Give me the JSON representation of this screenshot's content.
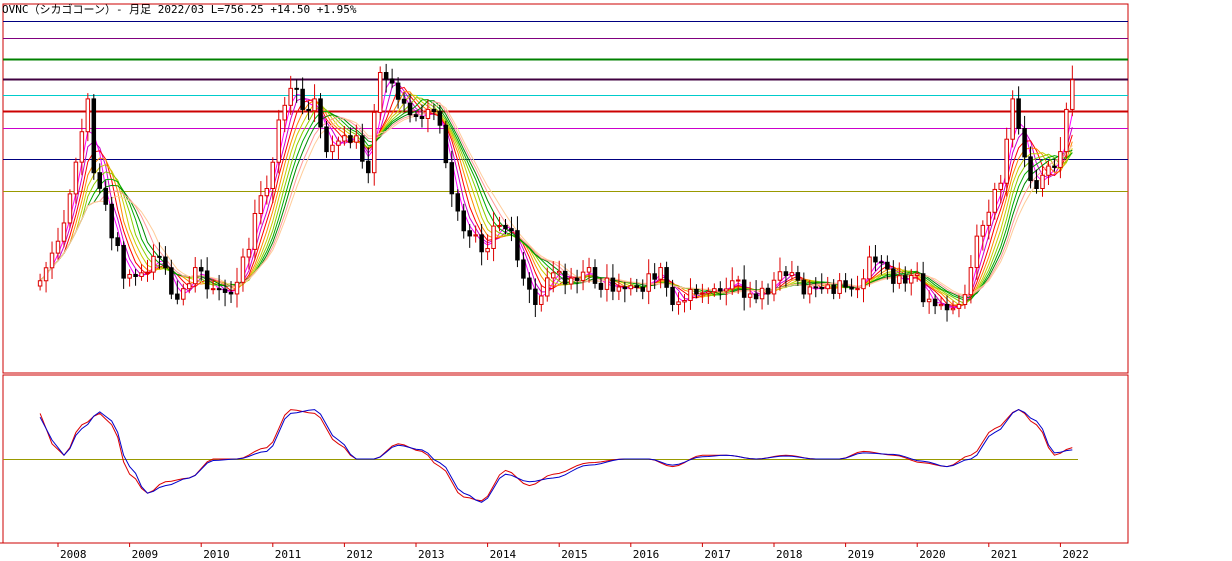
{
  "header": {
    "title": "OVNC（シカゴコーン）- 月足 2022/03 L=756.25 +14.50 +1.95%"
  },
  "colors": {
    "frame": "#cc0000",
    "up_candle": "#dd0000",
    "down_candle": "#000000",
    "oscillator_red": "#dd0000",
    "oscillator_blue": "#0000cc",
    "zero_line": "#999900",
    "ribbon": [
      "#ff00ff",
      "#cc00cc",
      "#ff0000",
      "#ff8800",
      "#cccc00",
      "#88cc00",
      "#00aa00",
      "#008800",
      "#ff9999",
      "#ffcc99"
    ]
  },
  "chart_data": [
    {
      "type": "candlestick",
      "title": "OVNC（シカゴコーン）- 月足 2022/03 L=756.25 +14.50 +1.95%",
      "xlabel": "",
      "ylabel": "",
      "x_tick_labels": [
        "2008",
        "2009",
        "2010",
        "2011",
        "2012",
        "2013",
        "2014",
        "2015",
        "2016",
        "2017",
        "2018",
        "2019",
        "2020",
        "2021",
        "2022"
      ],
      "ylim": [
        200,
        900
      ],
      "horizontal_lines": [
        {
          "value": 868,
          "color": "#000080"
        },
        {
          "value": 836,
          "color": "#800080"
        },
        {
          "value": 795,
          "color": "#008000"
        },
        {
          "value": 758,
          "color": "#400040"
        },
        {
          "value": 727,
          "color": "#00cccc"
        },
        {
          "value": 697,
          "color": "#cc0000"
        },
        {
          "value": 664,
          "color": "#cc00cc"
        },
        {
          "value": 606,
          "color": "#000080"
        },
        {
          "value": 546,
          "color": "#999900"
        }
      ],
      "series": [
        {
          "name": "",
          "period_start": "2007-10",
          "period_end": "2022-03",
          "close_anchors": [
            [
              "2007-10",
              375
            ],
            [
              "2008-01",
              450
            ],
            [
              "2008-04",
              600
            ],
            [
              "2008-06",
              720
            ],
            [
              "2008-07",
              580
            ],
            [
              "2008-09",
              520
            ],
            [
              "2008-12",
              380
            ],
            [
              "2009-03",
              390
            ],
            [
              "2009-06",
              420
            ],
            [
              "2009-09",
              340
            ],
            [
              "2009-12",
              400
            ],
            [
              "2010-03",
              360
            ],
            [
              "2010-06",
              350
            ],
            [
              "2010-08",
              420
            ],
            [
              "2010-12",
              550
            ],
            [
              "2011-02",
              680
            ],
            [
              "2011-04",
              740
            ],
            [
              "2011-06",
              700
            ],
            [
              "2011-08",
              720
            ],
            [
              "2011-10",
              620
            ],
            [
              "2011-12",
              640
            ],
            [
              "2012-03",
              650
            ],
            [
              "2012-05",
              580
            ],
            [
              "2012-07",
              770
            ],
            [
              "2012-09",
              750
            ],
            [
              "2012-12",
              690
            ],
            [
              "2013-03",
              700
            ],
            [
              "2013-05",
              670
            ],
            [
              "2013-07",
              540
            ],
            [
              "2013-10",
              460
            ],
            [
              "2013-12",
              430
            ],
            [
              "2014-03",
              480
            ],
            [
              "2014-05",
              470
            ],
            [
              "2014-07",
              380
            ],
            [
              "2014-09",
              330
            ],
            [
              "2014-12",
              390
            ],
            [
              "2015-03",
              380
            ],
            [
              "2015-06",
              400
            ],
            [
              "2015-07",
              370
            ],
            [
              "2015-09",
              380
            ],
            [
              "2015-12",
              360
            ],
            [
              "2016-03",
              355
            ],
            [
              "2016-06",
              400
            ],
            [
              "2016-08",
              330
            ],
            [
              "2016-12",
              350
            ],
            [
              "2017-03",
              360
            ],
            [
              "2017-06",
              375
            ],
            [
              "2017-09",
              350
            ],
            [
              "2017-12",
              350
            ],
            [
              "2018-03",
              385
            ],
            [
              "2018-06",
              350
            ],
            [
              "2018-09",
              360
            ],
            [
              "2018-12",
              375
            ],
            [
              "2019-03",
              360
            ],
            [
              "2019-05",
              420
            ],
            [
              "2019-07",
              410
            ],
            [
              "2019-09",
              370
            ],
            [
              "2019-12",
              385
            ],
            [
              "2020-03",
              340
            ],
            [
              "2020-06",
              320
            ],
            [
              "2020-08",
              330
            ],
            [
              "2020-10",
              400
            ],
            [
              "2020-12",
              480
            ],
            [
              "2021-03",
              560
            ],
            [
              "2021-05",
              720
            ],
            [
              "2021-07",
              610
            ],
            [
              "2021-09",
              550
            ],
            [
              "2021-12",
              590
            ],
            [
              "2022-01",
              620
            ],
            [
              "2022-02",
              700
            ],
            [
              "2022-03",
              756.25
            ]
          ]
        }
      ]
    },
    {
      "type": "line",
      "title": "",
      "xlabel": "",
      "ylabel": "",
      "ylim": [
        -1,
        1
      ],
      "series": [
        {
          "name": "",
          "color_key": "oscillator_red",
          "anchors": [
            [
              "2007-10",
              0.6
            ],
            [
              "2007-12",
              0.2
            ],
            [
              "2008-02",
              0.05
            ],
            [
              "2008-05",
              0.45
            ],
            [
              "2008-08",
              0.6
            ],
            [
              "2008-10",
              0.45
            ],
            [
              "2009-01",
              -0.2
            ],
            [
              "2009-04",
              -0.45
            ],
            [
              "2009-07",
              -0.3
            ],
            [
              "2009-11",
              -0.25
            ],
            [
              "2010-03",
              0.0
            ],
            [
              "2010-07",
              0.0
            ],
            [
              "2010-12",
              0.15
            ],
            [
              "2011-04",
              0.65
            ],
            [
              "2011-08",
              0.6
            ],
            [
              "2011-12",
              0.2
            ],
            [
              "2012-03",
              0.0
            ],
            [
              "2012-06",
              0.0
            ],
            [
              "2012-10",
              0.2
            ],
            [
              "2013-02",
              0.1
            ],
            [
              "2013-05",
              -0.1
            ],
            [
              "2013-09",
              -0.5
            ],
            [
              "2013-12",
              -0.55
            ],
            [
              "2014-04",
              -0.15
            ],
            [
              "2014-08",
              -0.35
            ],
            [
              "2014-12",
              -0.2
            ],
            [
              "2015-06",
              -0.05
            ],
            [
              "2015-12",
              0.0
            ],
            [
              "2016-04",
              0.0
            ],
            [
              "2016-08",
              -0.1
            ],
            [
              "2017-01",
              0.05
            ],
            [
              "2017-05",
              0.05
            ],
            [
              "2017-10",
              0.0
            ],
            [
              "2018-03",
              0.05
            ],
            [
              "2018-08",
              0.0
            ],
            [
              "2018-12",
              0.0
            ],
            [
              "2019-04",
              0.1
            ],
            [
              "2019-09",
              0.05
            ],
            [
              "2020-02",
              -0.05
            ],
            [
              "2020-06",
              -0.1
            ],
            [
              "2020-10",
              0.05
            ],
            [
              "2021-02",
              0.4
            ],
            [
              "2021-06",
              0.65
            ],
            [
              "2021-09",
              0.45
            ],
            [
              "2021-12",
              0.05
            ],
            [
              "2022-03",
              0.15
            ]
          ]
        },
        {
          "name": "",
          "color_key": "oscillator_blue",
          "anchors": [
            [
              "2007-10",
              0.55
            ],
            [
              "2007-12",
              0.25
            ],
            [
              "2008-02",
              0.05
            ],
            [
              "2008-05",
              0.4
            ],
            [
              "2008-08",
              0.62
            ],
            [
              "2008-10",
              0.5
            ],
            [
              "2009-01",
              -0.1
            ],
            [
              "2009-04",
              -0.45
            ],
            [
              "2009-07",
              -0.35
            ],
            [
              "2009-11",
              -0.25
            ],
            [
              "2010-03",
              -0.02
            ],
            [
              "2010-07",
              0.0
            ],
            [
              "2010-12",
              0.1
            ],
            [
              "2011-04",
              0.6
            ],
            [
              "2011-08",
              0.65
            ],
            [
              "2011-12",
              0.25
            ],
            [
              "2012-03",
              0.0
            ],
            [
              "2012-06",
              0.0
            ],
            [
              "2012-10",
              0.18
            ],
            [
              "2013-02",
              0.12
            ],
            [
              "2013-05",
              -0.05
            ],
            [
              "2013-09",
              -0.45
            ],
            [
              "2013-12",
              -0.57
            ],
            [
              "2014-04",
              -0.2
            ],
            [
              "2014-08",
              -0.3
            ],
            [
              "2014-12",
              -0.25
            ],
            [
              "2015-06",
              -0.08
            ],
            [
              "2015-12",
              0.0
            ],
            [
              "2016-04",
              0.0
            ],
            [
              "2016-08",
              -0.08
            ],
            [
              "2017-01",
              0.03
            ],
            [
              "2017-05",
              0.05
            ],
            [
              "2017-10",
              0.0
            ],
            [
              "2018-03",
              0.04
            ],
            [
              "2018-08",
              0.0
            ],
            [
              "2018-12",
              0.0
            ],
            [
              "2019-04",
              0.08
            ],
            [
              "2019-09",
              0.06
            ],
            [
              "2020-02",
              -0.03
            ],
            [
              "2020-06",
              -0.1
            ],
            [
              "2020-10",
              0.0
            ],
            [
              "2021-02",
              0.35
            ],
            [
              "2021-06",
              0.65
            ],
            [
              "2021-09",
              0.5
            ],
            [
              "2021-12",
              0.08
            ],
            [
              "2022-03",
              0.12
            ]
          ]
        }
      ],
      "zero_line": 0
    }
  ]
}
